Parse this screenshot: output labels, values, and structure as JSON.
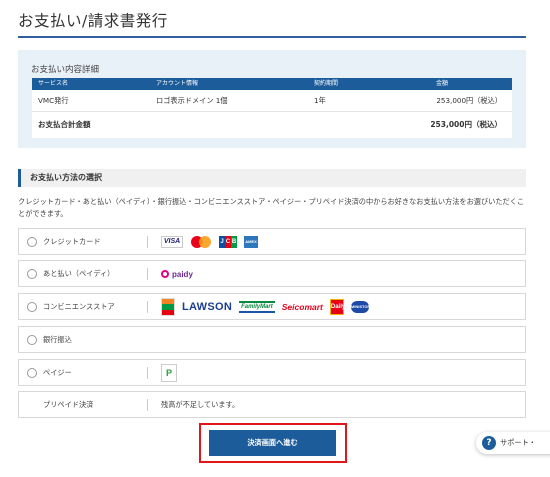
{
  "page": {
    "title": "お支払い/請求書発行"
  },
  "summary": {
    "title": "お支払い内容詳細",
    "columns": [
      "サービス名",
      "アカウント情報",
      "契約期間",
      "金額"
    ],
    "rows": [
      {
        "service": "VMC発行",
        "account": "ロゴ表示ドメイン 1個",
        "term": "1年",
        "amount": "253,000円（税込）"
      }
    ],
    "total_label": "お支払合計金額",
    "total_value": "253,000円（税込）"
  },
  "payment": {
    "section_title": "お支払い方法の選択",
    "description": "クレジットカード・あと払い（ペイディ）・銀行振込・コンビニエンスストア・ペイジー・プリペイド決済の中からお好きなお支払い方法をお選びいただくことができます。",
    "methods": [
      {
        "label": "クレジットカード",
        "logos": [
          "VISA",
          "Mastercard",
          "JCB",
          "AMEX"
        ],
        "icons": [
          "visa-logo",
          "mastercard-logo",
          "jcb-logo",
          "amex-logo"
        ]
      },
      {
        "label": "あと払い（ペイディ）",
        "logos": [
          "paidy"
        ],
        "icons": [
          "paidy-logo"
        ]
      },
      {
        "label": "コンビニエンスストア",
        "logos": [
          "LAWSON",
          "FamilyMart",
          "Seicomart",
          "Daily",
          "MINISTOP"
        ],
        "icons": [
          "seven-eleven-logo",
          "lawson-logo",
          "familymart-logo",
          "seicomart-logo",
          "daily-yamazaki-logo",
          "ministop-logo"
        ]
      },
      {
        "label": "銀行振込"
      },
      {
        "label": "ペイジー",
        "icons": [
          "payeasy-logo"
        ]
      },
      {
        "label": "プリペイド決済",
        "note": "残高が不足しています。"
      }
    ]
  },
  "actions": {
    "submit_label": "決済画面へ進む"
  },
  "support": {
    "label": "サポート・"
  },
  "colors": {
    "brand": "#1d5c9b",
    "highlight": "#e0161b",
    "panel": "#e8f0f8"
  }
}
